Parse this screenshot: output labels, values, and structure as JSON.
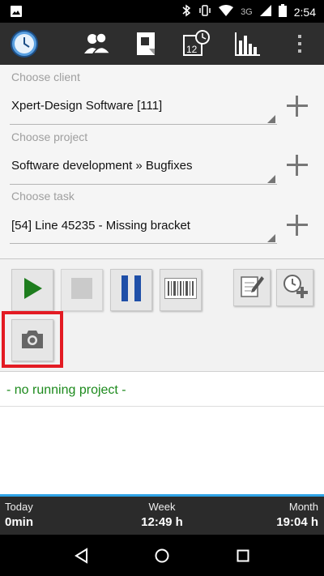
{
  "status_bar": {
    "network": "3G",
    "time": "2:54"
  },
  "toolbar": {
    "icons": [
      "clock-icon",
      "contacts-icon",
      "project-icon",
      "calendar-clock-icon",
      "chart-icon",
      "overflow-menu-icon"
    ]
  },
  "form": {
    "client": {
      "label": "Choose client",
      "value": "Xpert-Design Software [111]"
    },
    "project": {
      "label": "Choose project",
      "value": "Software development » Bugfixes"
    },
    "task": {
      "label": "Choose task",
      "value": "[54] Line 45235 - Missing bracket"
    }
  },
  "controls": {
    "buttons": [
      "play-icon",
      "stop-icon",
      "pause-icon",
      "barcode-icon",
      "note-edit-icon",
      "add-time-icon",
      "camera-icon"
    ]
  },
  "running": {
    "text": "- no running project -"
  },
  "stats": {
    "today": {
      "label": "Today",
      "value": "0min"
    },
    "week": {
      "label": "Week",
      "value": "12:49 h"
    },
    "month": {
      "label": "Month",
      "value": "19:04 h"
    }
  },
  "colors": {
    "accent": "#2ea3e6",
    "play_green": "#1e7d1e",
    "pause_blue": "#1f4fa8",
    "running_text": "#1c8a1c",
    "highlight": "#e31b23"
  }
}
